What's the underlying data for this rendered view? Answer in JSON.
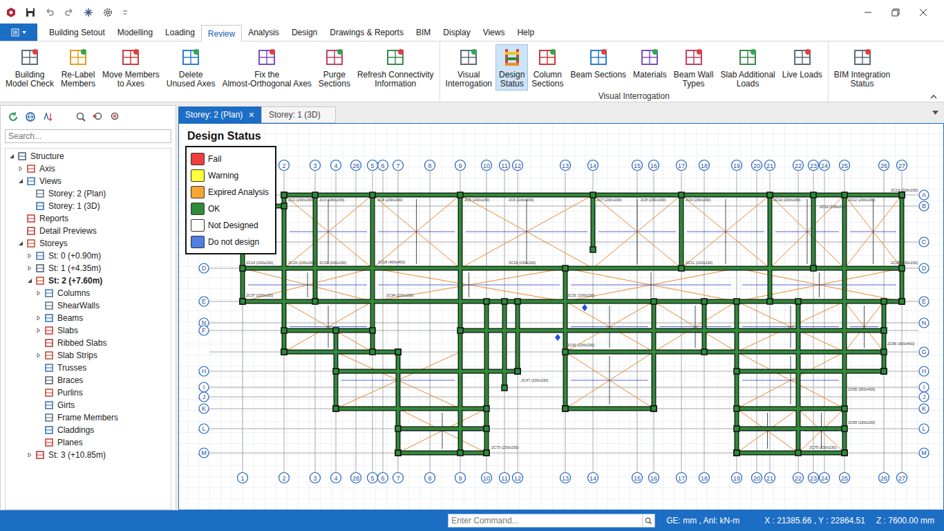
{
  "window": {
    "title": ""
  },
  "menu": {
    "tabs": [
      {
        "label": "Building Setout",
        "selected": false
      },
      {
        "label": "Modelling",
        "selected": false
      },
      {
        "label": "Loading",
        "selected": false
      },
      {
        "label": "Review",
        "selected": true
      },
      {
        "label": "Analysis",
        "selected": false
      },
      {
        "label": "Design",
        "selected": false
      },
      {
        "label": "Drawings & Reports",
        "selected": false
      },
      {
        "label": "BIM",
        "selected": false
      },
      {
        "label": "Display",
        "selected": false
      },
      {
        "label": "Views",
        "selected": false
      },
      {
        "label": "Help",
        "selected": false
      }
    ]
  },
  "ribbon": {
    "groups": [
      {
        "label": "",
        "buttons": [
          {
            "lines": [
              "Building",
              "Model Check"
            ],
            "selected": false
          },
          {
            "lines": [
              "Re-Label",
              "Members"
            ],
            "selected": false
          },
          {
            "lines": [
              "Move Members",
              "to Axes"
            ],
            "selected": false
          },
          {
            "lines": [
              "Delete",
              "Unused Axes"
            ],
            "selected": false
          },
          {
            "lines": [
              "Fix the",
              "Almost-Orthogonal Axes"
            ],
            "selected": false
          },
          {
            "lines": [
              "Purge",
              "Sections"
            ],
            "selected": false
          },
          {
            "lines": [
              "Refresh Connectivity",
              "Information"
            ],
            "selected": false
          }
        ]
      },
      {
        "label": "Visual Interrogation",
        "buttons": [
          {
            "lines": [
              "Visual",
              "Interrogation"
            ],
            "selected": false
          },
          {
            "lines": [
              "Design",
              "Status"
            ],
            "selected": true
          },
          {
            "lines": [
              "Column",
              "Sections"
            ],
            "selected": false
          },
          {
            "lines": [
              "Beam Sections"
            ],
            "selected": false
          },
          {
            "lines": [
              "Materials"
            ],
            "selected": false
          },
          {
            "lines": [
              "Beam Wall",
              "Types"
            ],
            "selected": false
          },
          {
            "lines": [
              "Slab Additional",
              "Loads"
            ],
            "selected": false
          },
          {
            "lines": [
              "Live Loads"
            ],
            "selected": false
          }
        ]
      },
      {
        "label": "",
        "buttons": [
          {
            "lines": [
              "BIM Integration",
              "Status"
            ],
            "selected": false
          }
        ]
      }
    ]
  },
  "sidebar": {
    "search": {
      "placeholder": "Search..."
    },
    "tree": [
      {
        "label": "Structure",
        "level": 0,
        "expandable": true,
        "expanded": true,
        "selected": false
      },
      {
        "label": "Axis",
        "level": 1,
        "expandable": true,
        "expanded": false,
        "selected": false
      },
      {
        "label": "Views",
        "level": 1,
        "expandable": true,
        "expanded": true,
        "selected": false
      },
      {
        "label": "Storey: 2 (Plan)",
        "level": 2,
        "expandable": false,
        "expanded": false,
        "selected": false
      },
      {
        "label": "Storey: 1 (3D)",
        "level": 2,
        "expandable": false,
        "expanded": false,
        "selected": false
      },
      {
        "label": "Reports",
        "level": 1,
        "expandable": false,
        "expanded": false,
        "selected": false
      },
      {
        "label": "Detail Previews",
        "level": 1,
        "expandable": false,
        "expanded": false,
        "selected": false
      },
      {
        "label": "Storeys",
        "level": 1,
        "expandable": true,
        "expanded": true,
        "selected": false
      },
      {
        "label": "St: 0 (+0.90m)",
        "level": 2,
        "expandable": true,
        "expanded": false,
        "selected": false
      },
      {
        "label": "St: 1 (+4.35m)",
        "level": 2,
        "expandable": true,
        "expanded": false,
        "selected": false
      },
      {
        "label": "St: 2 (+7.60m)",
        "level": 2,
        "expandable": true,
        "expanded": true,
        "selected": true
      },
      {
        "label": "Columns",
        "level": 3,
        "expandable": true,
        "expanded": false,
        "selected": false
      },
      {
        "label": "ShearWalls",
        "level": 3,
        "expandable": false,
        "expanded": false,
        "selected": false
      },
      {
        "label": "Beams",
        "level": 3,
        "expandable": true,
        "expanded": false,
        "selected": false
      },
      {
        "label": "Slabs",
        "level": 3,
        "expandable": true,
        "expanded": false,
        "selected": false
      },
      {
        "label": "Ribbed Slabs",
        "level": 3,
        "expandable": false,
        "expanded": false,
        "selected": false
      },
      {
        "label": "Slab Strips",
        "level": 3,
        "expandable": true,
        "expanded": false,
        "selected": false
      },
      {
        "label": "Trusses",
        "level": 3,
        "expandable": false,
        "expanded": false,
        "selected": false
      },
      {
        "label": "Braces",
        "level": 3,
        "expandable": false,
        "expanded": false,
        "selected": false
      },
      {
        "label": "Purlins",
        "level": 3,
        "expandable": false,
        "expanded": false,
        "selected": false
      },
      {
        "label": "Girts",
        "level": 3,
        "expandable": false,
        "expanded": false,
        "selected": false
      },
      {
        "label": "Frame Members",
        "level": 3,
        "expandable": false,
        "expanded": false,
        "selected": false
      },
      {
        "label": "Claddings",
        "level": 3,
        "expandable": false,
        "expanded": false,
        "selected": false
      },
      {
        "label": "Planes",
        "level": 3,
        "expandable": false,
        "expanded": false,
        "selected": false
      },
      {
        "label": "St: 3 (+10.85m)",
        "level": 2,
        "expandable": true,
        "expanded": false,
        "selected": false
      }
    ]
  },
  "document_tabs": [
    {
      "label": "Storey: 2 (Plan)",
      "selected": true,
      "close": "×"
    },
    {
      "label": "Storey: 1 (3D)",
      "selected": false,
      "close": ""
    }
  ],
  "canvas": {
    "column_axes": [
      "1",
      "2",
      "3",
      "4",
      "28",
      "5",
      "6",
      "7",
      "8",
      "9",
      "10",
      "11",
      "12",
      "13",
      "14",
      "15",
      "16",
      "17",
      "18",
      "19",
      "20",
      "21",
      "22",
      "23",
      "24",
      "25",
      "26",
      "27"
    ],
    "row_axes": [
      {
        "label": "A",
        "left": false,
        "right": true
      },
      {
        "label": "B",
        "left": false,
        "right": true
      },
      {
        "label": "C",
        "left": false,
        "right": true
      },
      {
        "label": "D",
        "left": true,
        "right": true
      },
      {
        "label": "E",
        "left": true,
        "right": true
      },
      {
        "label": "N",
        "left": true,
        "right": true
      },
      {
        "label": "F",
        "left": true,
        "right": false
      },
      {
        "label": "G",
        "left": false,
        "right": true
      },
      {
        "label": "H",
        "left": true,
        "right": true
      },
      {
        "label": "I",
        "left": true,
        "right": true
      },
      {
        "label": "J",
        "left": true,
        "right": true
      },
      {
        "label": "K",
        "left": true,
        "right": true
      },
      {
        "label": "L",
        "left": true,
        "right": true
      },
      {
        "label": "M",
        "left": true,
        "right": true
      }
    ],
    "member_labels": [
      "2C2 (230x230)",
      "2C3 (230x230)",
      "2C4 (230x230)",
      "2C5 (230x230)",
      "2C6 (230x230)",
      "2C7 (230x230)",
      "2C8 (230x230)",
      "2C9 (230x230)",
      "2C10 (230x230)",
      "2C11 (230x230)",
      "2C12 (230x230)",
      "2C13 (230x230)",
      "2C14 (230x230)",
      "2C15 (230x230)",
      "2C16 (230x230)",
      "2C18 (400x400)",
      "2C19 (230x230)",
      "2C21 (230x230)",
      "2C25 (230x230)",
      "2C37 (230x230)",
      "2C34 (230x230)",
      "2C31 (230x230)",
      "2C41 (230x230)",
      "2C47 (230x230)",
      "2C66 (300x400)",
      "2C65 (300x400)",
      "2C69 (230x230)",
      "2C73 (230x230)",
      "2C75 (230x230)"
    ],
    "legend": {
      "title": "Design Status",
      "items": [
        {
          "label": "Fail",
          "color": "#f03c3c"
        },
        {
          "label": "Warning",
          "color": "#ffff3a"
        },
        {
          "label": "Expired Analysis",
          "color": "#f6a533"
        },
        {
          "label": "OK",
          "color": "#2f8a3a"
        },
        {
          "label": "Not Designed",
          "color": "#ffffff"
        },
        {
          "label": "Do not design",
          "color": "#4f7fe0"
        }
      ]
    }
  },
  "status_bar": {
    "command": {
      "placeholder": "Enter Command..."
    },
    "units": "GE: mm , Anl: kN-m",
    "xy": "X : 21385.66 , Y : 22864.51",
    "z": "Z : 7600.00 mm"
  }
}
